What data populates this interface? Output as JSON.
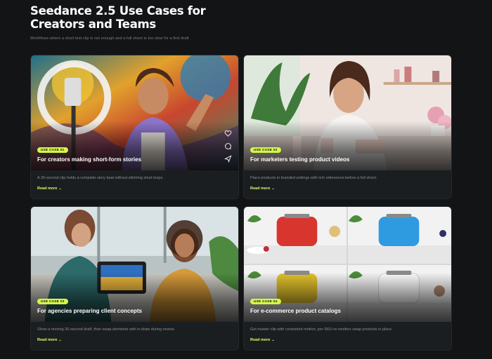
{
  "page": {
    "title_line1": "Seedance 2.5 Use Cases for",
    "title_line2": "Creators and Teams",
    "subtitle": "Workflows where a short test clip is not enough and a full shoot is too slow for a first draft"
  },
  "cards": [
    {
      "badge": "USE CASE 01",
      "title": "For creators making short-form stories",
      "description": "A 30-second clip holds a complete story beat without stitching short loops.",
      "read_more": "Read more",
      "icons": [
        "heart-icon",
        "comment-icon",
        "send-icon"
      ]
    },
    {
      "badge": "USE CASE 02",
      "title": "For marketers testing product videos",
      "description": "Place products in branded settings with rich references before a full shoot.",
      "read_more": "Read more"
    },
    {
      "badge": "USE CASE 03",
      "title": "For agencies preparing client concepts",
      "description": "Show a moving 30-second draft, then swap elements with in-draw during review.",
      "read_more": "Read more"
    },
    {
      "badge": "USE CASE 04",
      "title": "For e-commerce product catalogs",
      "description": "Get master clip with consistent motion; per-SKU re-renders swap products in place.",
      "read_more": "Read more"
    }
  ],
  "colors": {
    "accent": "#d4f54a",
    "background": "#121416",
    "card": "#1b1e20"
  }
}
